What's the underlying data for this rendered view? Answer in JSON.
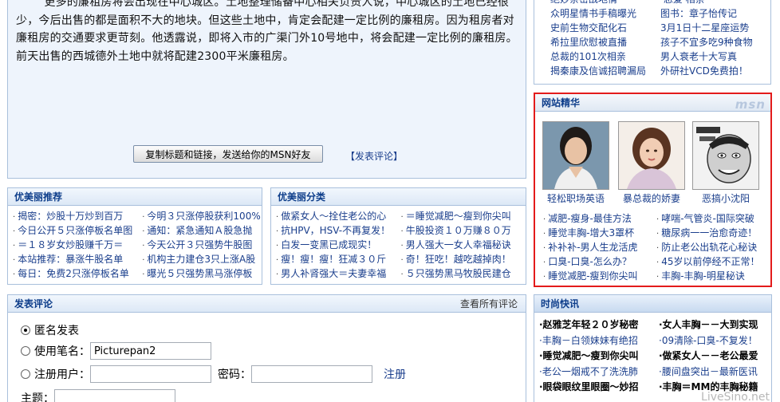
{
  "article": {
    "paragraph1": "“更多的廉租房将会出现在中心城区。”土地整理储备中心相关负责人说，中心城区的土地已经很少，今后出售的都是面积不大的地块。但这些土地中，肯定会配建一定比例的廉租房。因为租房者对廉租房的交通要求更苛刻。他透露说，即将入市的广渠门外10号地中，将会配建一定比例的廉租房。前天出售的西城德外土地中就将配建2300平米廉租房。",
    "copy_button": "复制标题和链接，发送给你的MSN好友",
    "comment_link": "【发表评论】"
  },
  "recommend": {
    "title": "优美丽推荐",
    "left": [
      "揭密：炒股十万炒到百万",
      "今日公开５只涨停板名单图",
      "＝１８岁女炒股赚千万＝",
      "本站推荐：暴涨牛股名单",
      "每日：免费2只涨停板名单"
    ],
    "right": [
      "今明３只涨停股获利100%",
      "通知：紧急通知Ａ股急抛",
      "今天公开３只强势牛股图",
      "机构主力建仓3只上涨A股",
      "曝光５只强势黑马涨停板"
    ]
  },
  "category": {
    "title": "优美丽分类",
    "left": [
      "做紧女人～拴住老公的心",
      "抗HPV，HSV-不再复发！",
      "白发一变黑已成现实！",
      "瘦！瘦！瘦！狂减３０斤",
      "男人补肾强大＝夫妻幸福"
    ],
    "right": [
      "＝睡觉减肥～瘦到你尖叫",
      "牛股投资１０万赚８０万",
      "男人强大一女人幸福秘诀",
      "奇！狂吃！越吃越掉肉！",
      "５只强势黑马牧股民建仓"
    ]
  },
  "comment_form": {
    "title": "发表评论",
    "view_all": "查看所有评论",
    "anonymous_label": "匿名发表",
    "penname_label": "使用笔名：",
    "penname_value": "Picturepan2",
    "registered_label": "注册用户：",
    "password_label": "密码：",
    "register_link": "注册",
    "subject_label": "主题："
  },
  "top_links": {
    "left": [
      "绝妙亲密战地情",
      "众明星情书手稿曝光",
      "史前生物交配化石",
      "希拉里欣慰被直播",
      "总裁的101次相亲",
      "揭秦康及信诚招聘漏局"
    ],
    "right": [
      "·恋爱 相亲",
      "图书：章子怡传记",
      "3月1日十二星座运势",
      "孩子不宜多吃9种食物",
      "男人衰老十大写真",
      "外研社VCD免费拍！"
    ]
  },
  "msn": {
    "title": "网站精华",
    "logo": "msn",
    "captions": [
      "轻松职场英语",
      "暴总裁的娇妻",
      "恶搞小沈阳"
    ],
    "left": [
      "减肥-瘦身-最佳方法",
      "睡觉丰胸-增大3罩杯",
      "补补补-男人生龙活虎",
      "口臭-口臭-怎么办？",
      "睡觉减肥-瘦到你尖叫"
    ],
    "right": [
      "哮喘-气管炎-国际突破",
      "糖尿病一一治愈奇迹！",
      "防止老公出轨花心秘诀",
      "45岁以前停经不正常！",
      "丰胸-丰胸-明星秘诀"
    ]
  },
  "fashion": {
    "title": "时尚快讯",
    "rows": [
      {
        "l": "·赵雅芝年轻２０岁秘密",
        "r": "·女人丰胸－－大到实现"
      },
      {
        "l": "·丰胸－白领妹妹有绝招",
        "r": "·09清除-口臭-不复发！"
      },
      {
        "l": "·睡觉减肥～瘦到你尖叫",
        "r": "·做紧女人－－老公最爱"
      },
      {
        "l": "·老公一烟戒不了洗洗肺",
        "r": "·腰间盘突出－最新医讯"
      },
      {
        "l": "·眼袋眼纹里眼圈～妙招",
        "r": "·丰胸＝MM的丰胸秘籍"
      }
    ]
  },
  "watermark": "LiveSino.net"
}
